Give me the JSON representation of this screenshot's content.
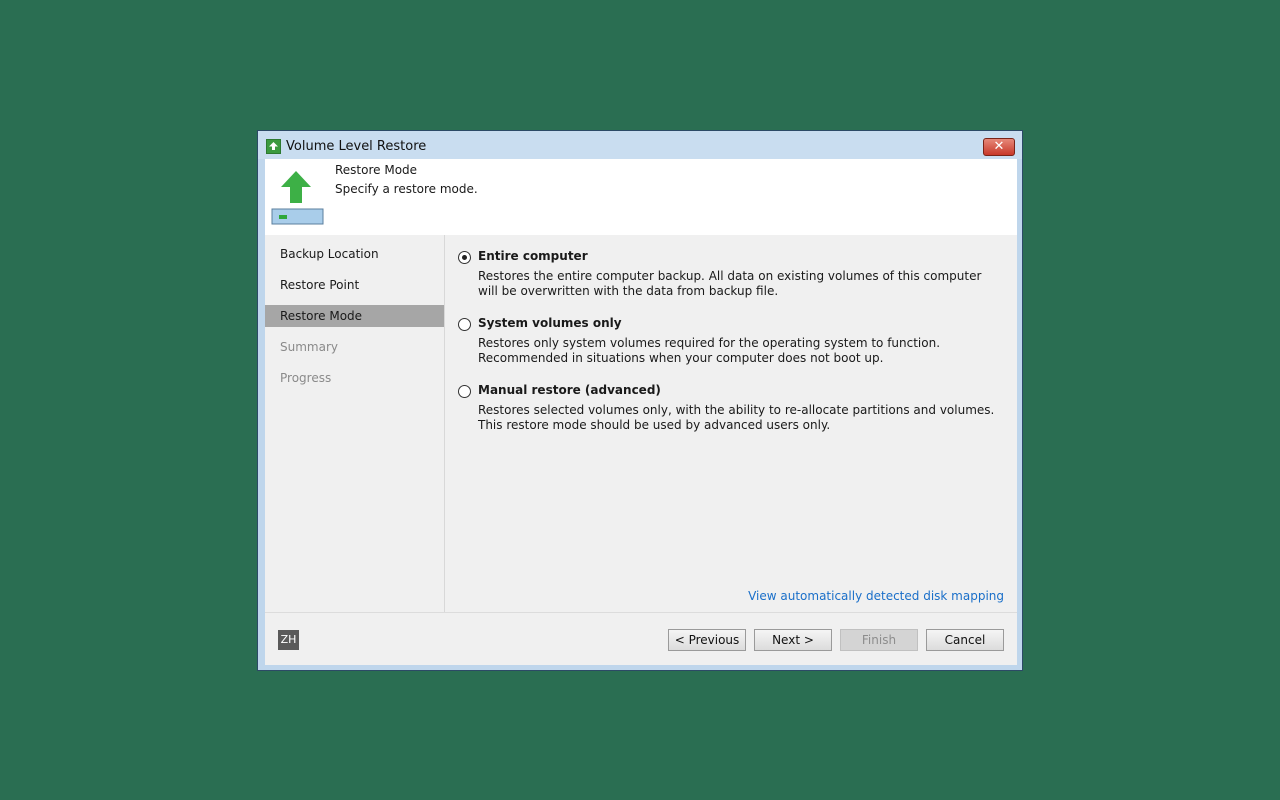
{
  "window": {
    "title": "Volume Level Restore",
    "close_label": "✕"
  },
  "header": {
    "title": "Restore Mode",
    "subtitle": "Specify a restore mode."
  },
  "steps": [
    {
      "label": "Backup Location",
      "state": "done"
    },
    {
      "label": "Restore Point",
      "state": "done"
    },
    {
      "label": "Restore Mode",
      "state": "active"
    },
    {
      "label": "Summary",
      "state": "disabled"
    },
    {
      "label": "Progress",
      "state": "disabled"
    }
  ],
  "options": [
    {
      "label": "Entire computer",
      "description": "Restores the entire computer backup. All data on existing volumes of this computer will be overwritten with the data from backup file.",
      "selected": true
    },
    {
      "label": "System volumes only",
      "description": "Restores only system volumes required for the operating system to function. Recommended in situations when your computer does not boot up.",
      "selected": false
    },
    {
      "label": "Manual restore (advanced)",
      "description": "Restores selected volumes only, with the ability to re-allocate partitions and volumes. This restore mode should be used by advanced users only.",
      "selected": false
    }
  ],
  "mapping_link": "View automatically detected disk mapping",
  "footer": {
    "language": "ZH",
    "previous": "< Previous",
    "next": "Next >",
    "finish": "Finish",
    "cancel": "Cancel"
  },
  "colors": {
    "desktop": "#2a6e52",
    "accent_green": "#3b9a3f",
    "link": "#1a6fc9",
    "active_step": "#a6a6a6"
  },
  "icons": {
    "title": "restore-arrow-icon",
    "header": "restore-drive-icon",
    "close": "close-icon"
  }
}
